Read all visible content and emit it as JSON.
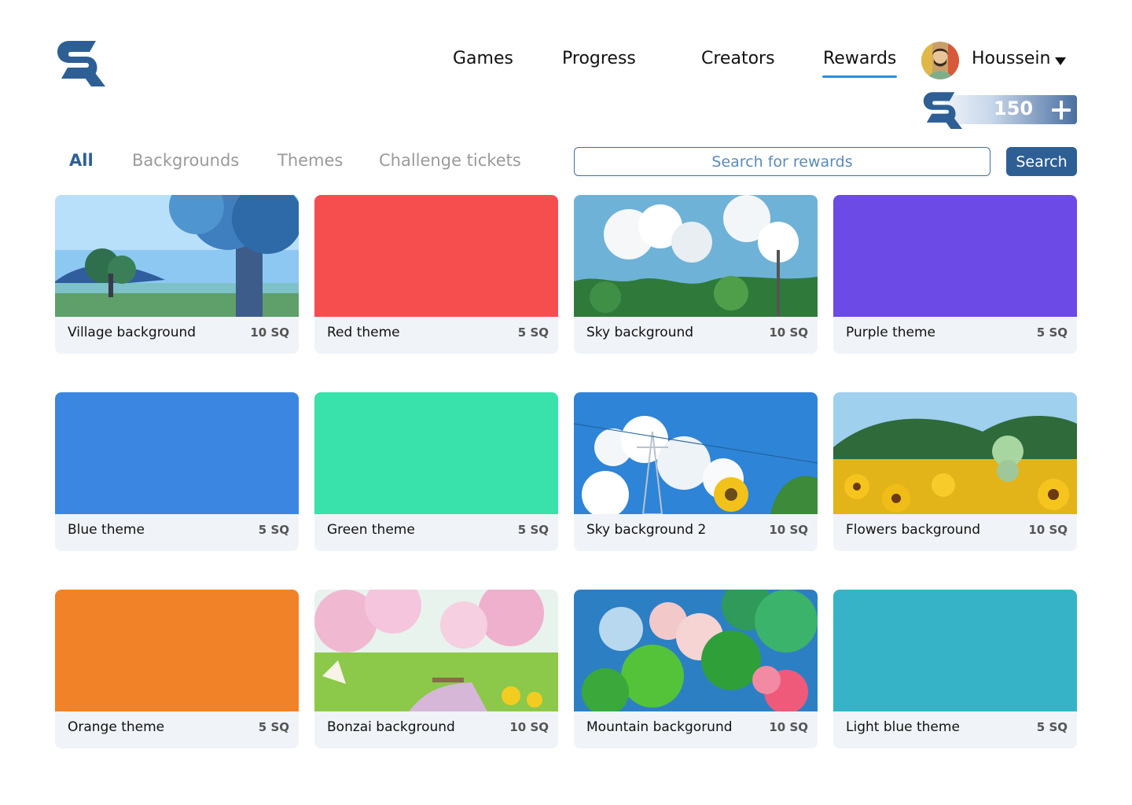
{
  "header": {
    "logo": {
      "icon": "sr-logo-icon",
      "color": "#2e5f94"
    },
    "nav": [
      {
        "label": "Games",
        "active": false
      },
      {
        "label": "Progress",
        "active": false
      },
      {
        "label": "Creators",
        "active": false
      },
      {
        "label": "Rewards",
        "active": true
      }
    ],
    "user": {
      "name": "Houssein",
      "avatar": "avatar-photo",
      "caret": "caret-down-icon"
    },
    "balance": {
      "value": "150",
      "add_icon": "plus-icon",
      "currency_icon": "sr-logo-icon"
    }
  },
  "filters": {
    "tabs": [
      {
        "label": "All",
        "active": true
      },
      {
        "label": "Backgrounds",
        "active": false
      },
      {
        "label": "Themes",
        "active": false
      },
      {
        "label": "Challenge tickets",
        "active": false
      }
    ],
    "search": {
      "placeholder": "Search for rewards",
      "value": "",
      "button_label": "Search"
    }
  },
  "rewards": [
    {
      "name": "Village background",
      "price": "10 SQ",
      "kind": "image",
      "scene": "village"
    },
    {
      "name": "Red theme",
      "price": "5 SQ",
      "kind": "color",
      "color": "#f64d4f"
    },
    {
      "name": "Sky background",
      "price": "10 SQ",
      "kind": "image",
      "scene": "sky"
    },
    {
      "name": "Purple theme",
      "price": "5 SQ",
      "kind": "color",
      "color": "#6b4ae6"
    },
    {
      "name": "Blue theme",
      "price": "5 SQ",
      "kind": "color",
      "color": "#3a86e0"
    },
    {
      "name": "Green theme",
      "price": "5 SQ",
      "kind": "color",
      "color": "#38e2aa"
    },
    {
      "name": "Sky background 2",
      "price": "10 SQ",
      "kind": "image",
      "scene": "sky2"
    },
    {
      "name": "Flowers background",
      "price": "10 SQ",
      "kind": "image",
      "scene": "flowers"
    },
    {
      "name": "Orange theme",
      "price": "5 SQ",
      "kind": "color",
      "color": "#f28227"
    },
    {
      "name": "Bonzai background",
      "price": "10 SQ",
      "kind": "image",
      "scene": "bonzai"
    },
    {
      "name": "Mountain backgorund",
      "price": "10 SQ",
      "kind": "image",
      "scene": "mountain"
    },
    {
      "name": "Light blue theme",
      "price": "5 SQ",
      "kind": "color",
      "color": "#36b3c6"
    }
  ]
}
